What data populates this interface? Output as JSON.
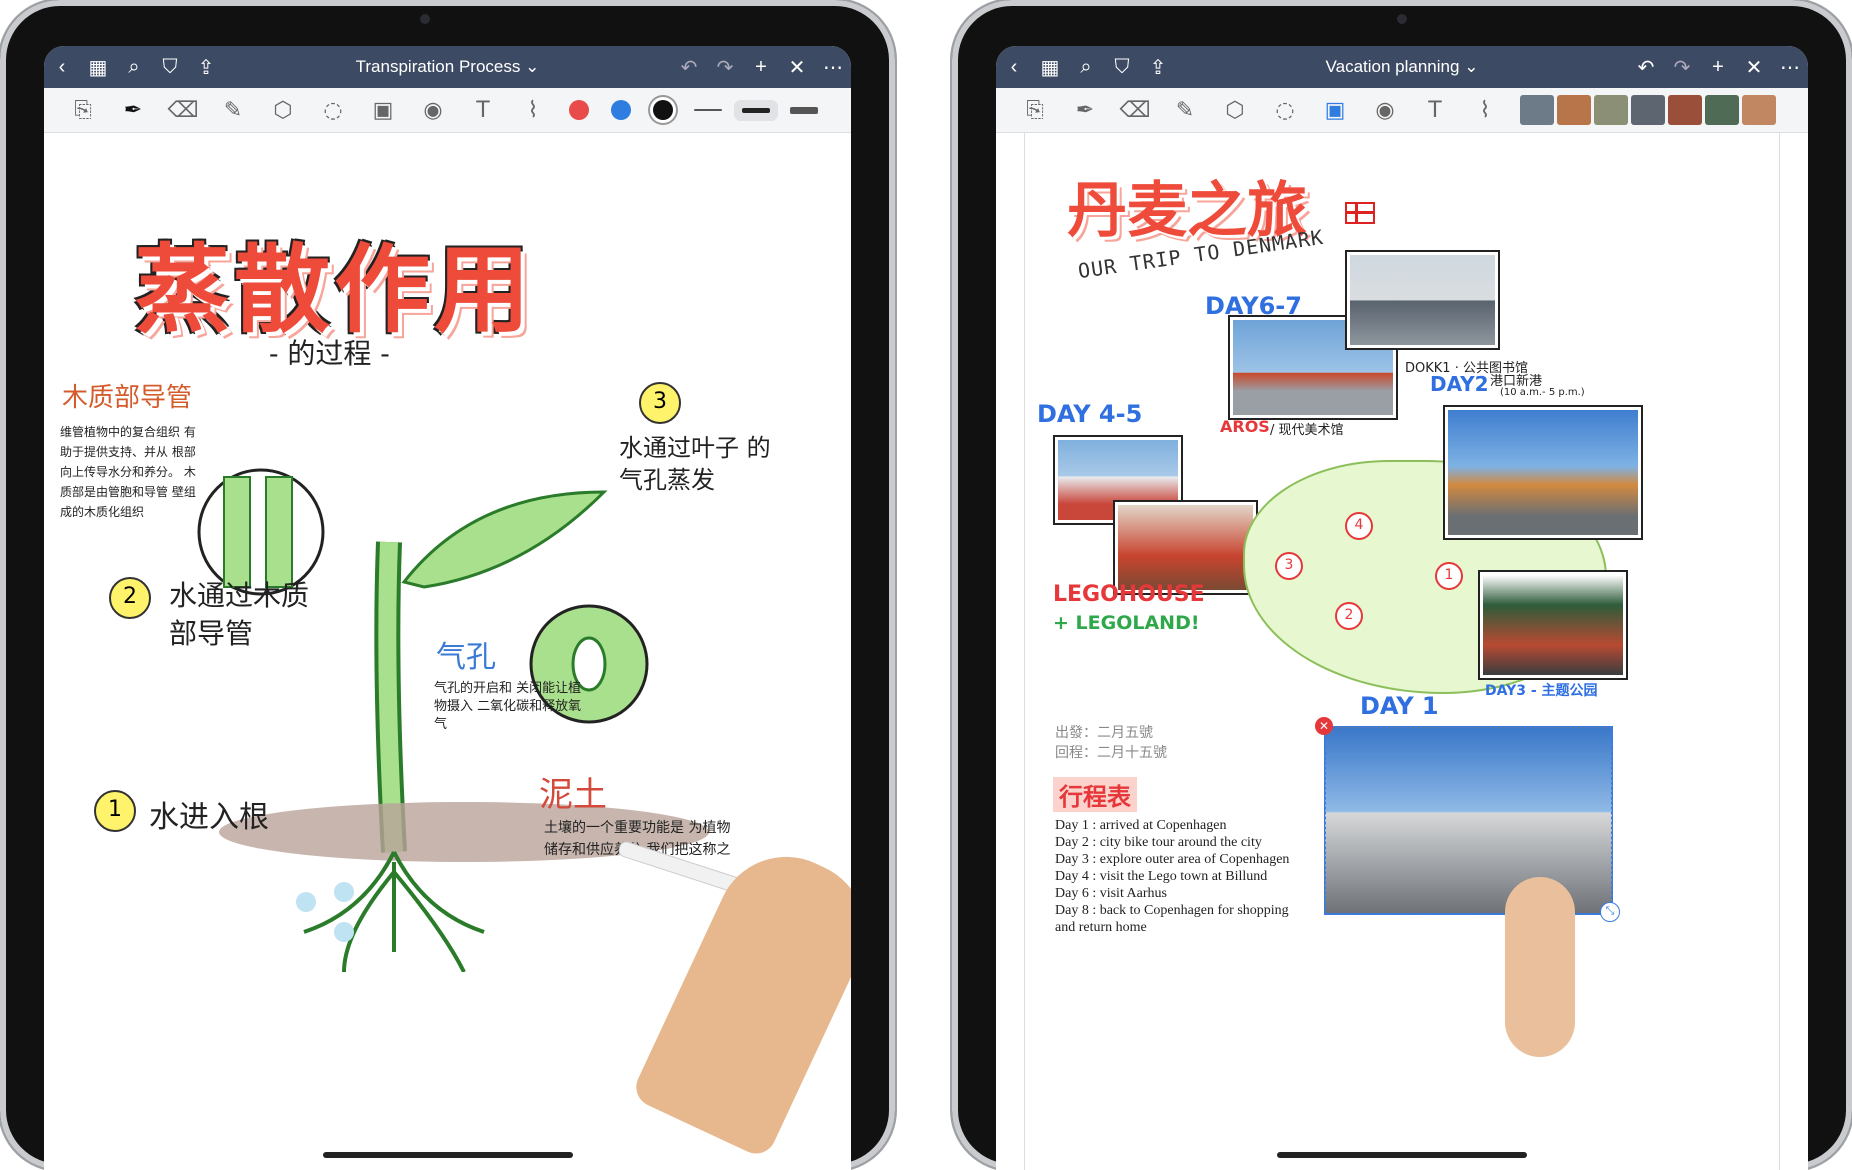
{
  "left_app": {
    "navbar": {
      "title": "Transpiration Process",
      "chevron": "⌄",
      "icons": {
        "back": "‹",
        "grid": "▦",
        "search": "⌕",
        "bookmark": "⛉",
        "share": "⇪",
        "undo": "↶",
        "redo": "↷",
        "add": "+",
        "close": "✕",
        "more": "⋯"
      }
    },
    "toolbar": {
      "icons": [
        "sidebar-icon",
        "pen-icon",
        "eraser-icon",
        "highlighter-icon",
        "shapes-icon",
        "lasso-icon",
        "image-icon",
        "camera-icon",
        "text-icon",
        "laser-icon"
      ],
      "glyphs": [
        "⎘",
        "✒",
        "⌫",
        "✎",
        "⬡",
        "◌",
        "▣",
        "◉",
        "T",
        "⌇"
      ],
      "colors": [
        "#e94b4b",
        "#2f7de1",
        "#111111"
      ]
    },
    "note": {
      "title": "蒸散作用",
      "subtitle": "- 的过程 -",
      "xylem_heading": "木质部导管",
      "xylem_text": "维管植物中的复合组织 有助于提供支持、并从 根部向上传导水分和养分。 木质部是由管胞和导管 壁组成的木质化组织",
      "num3": "3",
      "leaf_note": "水通过叶子 的气孔蒸发",
      "stomata_heading": "气孔",
      "stomata_text": "气孔的开启和 关闭能让植物摄入 二氧化碳和释放氧气",
      "num2": "2",
      "xylem_note": "水通过木质 部导管",
      "soil_heading": "泥土",
      "soil_text": "土壤的一个重要功能是 为植物储存和供应养分 我们把这称之",
      "num1": "1",
      "root_note": "水进入根"
    }
  },
  "right_app": {
    "navbar": {
      "title": "Vacation planning",
      "chevron": "⌄"
    },
    "toolbar": {
      "thumb_colors": [
        "#6d7a88",
        "#b8754a",
        "#8a8f76",
        "#5d6670",
        "#9a4f3a",
        "#4f6b56",
        "#c08762"
      ]
    },
    "note": {
      "title": "丹麦之旅",
      "subtitle": "OUR TRIP TO DENMARK",
      "day67": "DAY6-7",
      "day45": "DAY 4-5",
      "day2": "DAY2",
      "day3": "DAY3 - 主题公园",
      "day1": "DAY 1",
      "caption_dokk": "DOKK1 · 公共图书馆",
      "caption_aros": "AROS",
      "caption_aros_cn": "/ 现代美术馆",
      "caption_day2": "港口新港",
      "caption_day2_small": "(10 a.m.- 5 p.m.)",
      "legohouse": "LEGOHOUSE",
      "legoland": "+ LEGOLAND!",
      "departure": "出發：二月五號",
      "return": "回程：二月十五號",
      "itinerary_heading": "行程表",
      "itinerary": [
        "Day 1 : arrived at Copenhagen",
        "Day 2 : city bike tour around the city",
        "Day 3 : explore outer area of Copenhagen",
        "Day 4 : visit the Lego town at Billund",
        "Day 6 : visit Aarhus",
        "Day 8 : back to Copenhagen for shopping",
        "and return home"
      ],
      "map_labels": [
        "1",
        "2",
        "3",
        "4"
      ]
    }
  }
}
